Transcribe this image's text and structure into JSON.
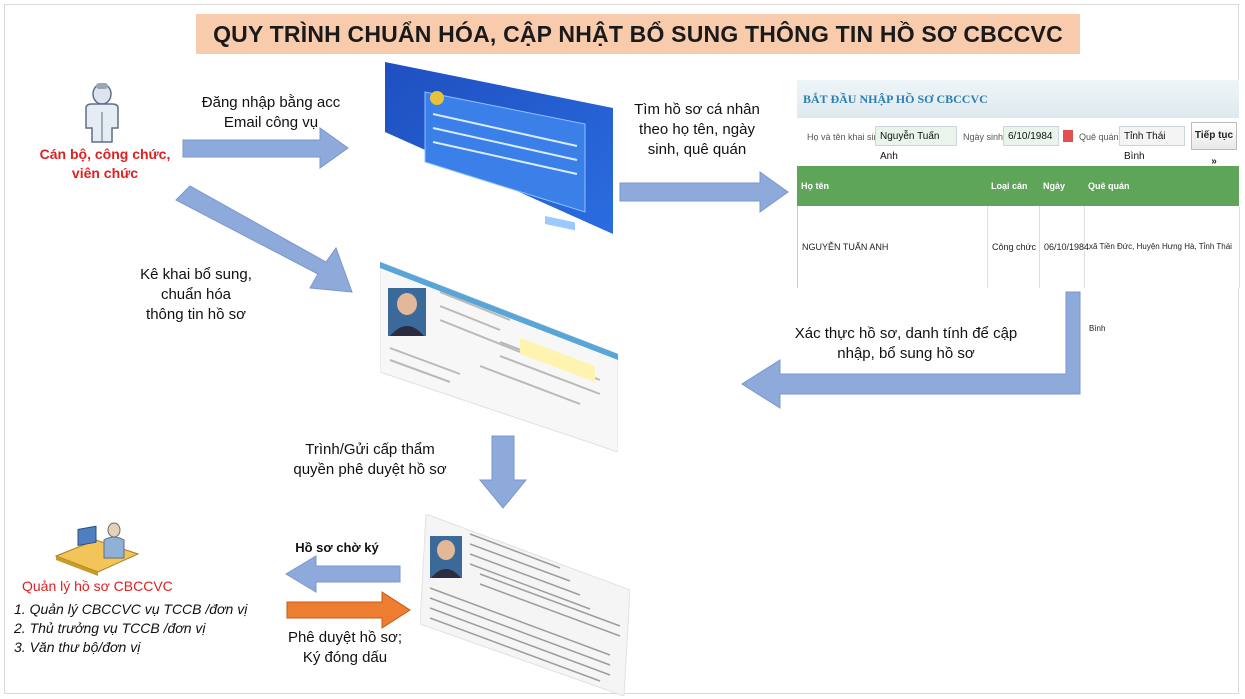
{
  "title": "QUY TRÌNH CHUẨN HÓA, CẬP NHẬT BỔ SUNG THÔNG TIN HỒ SƠ CBCCVC",
  "actor": {
    "label_line1": "Cán bộ, công chức,",
    "label_line2": "viên chức",
    "icon": "person-icon"
  },
  "steps": {
    "login_line1": "Đăng nhập bằng acc",
    "login_line2": "Email công vụ",
    "search_line1": "Tìm hồ sơ cá nhân",
    "search_line2": "theo họ tên, ngày",
    "search_line3": "sinh, quê quán",
    "declare_line1": "Kê khai bổ sung,",
    "declare_line2": "chuẩn hóa",
    "declare_line3": "thông tin hồ sơ",
    "verify_line1": "Xác thực hồ sơ, danh tính để cập",
    "verify_line2": "nhập, bổ sung  hồ sơ",
    "submit_line1": "Trình/Gửi cấp thẩm",
    "submit_line2": "quyền phê duyệt hồ sơ",
    "pending": "Hồ sơ chờ ký",
    "approve_line1": "Phê duyệt hồ sơ;",
    "approve_line2": "Ký đóng dấu"
  },
  "manager": {
    "title": "Quản lý hồ sơ CBCCVC",
    "items": [
      "1. Quản lý CBCCVC vụ TCCB /đơn vị",
      "2. Thủ trưởng vụ TCCB /đơn vị",
      "3. Văn thư bộ/đơn vị"
    ],
    "icon": "office-worker-icon"
  },
  "form": {
    "header": "BẮT ĐẦU NHẬP HỒ SƠ CBCCVC",
    "name_label": "Họ và tên khai sinh (*)",
    "name_value": "Nguyễn Tuấn Anh",
    "dob_label": "Ngày sinh(*)",
    "dob_value": "6/10/1984",
    "hometown_label": "Quê quán (*)",
    "hometown_value": "Tỉnh Thái Bình",
    "continue_label": "Tiếp tục »",
    "columns": [
      "Họ tên",
      "Loại cán bộ",
      "Ngày sinh",
      "Quê quán"
    ],
    "row": [
      "NGUYỄN TUẤN ANH",
      "Công chức",
      "06/10/1984",
      "xã Tiền Đức, Huyện Hưng Hà, Tỉnh Thái Bình"
    ]
  },
  "colors": {
    "title_bg": "#f8cbad",
    "arrow_blue": "#8eaadb",
    "arrow_orange": "#ed7d31",
    "red_text": "#e02020",
    "table_green": "#5ea55a"
  }
}
